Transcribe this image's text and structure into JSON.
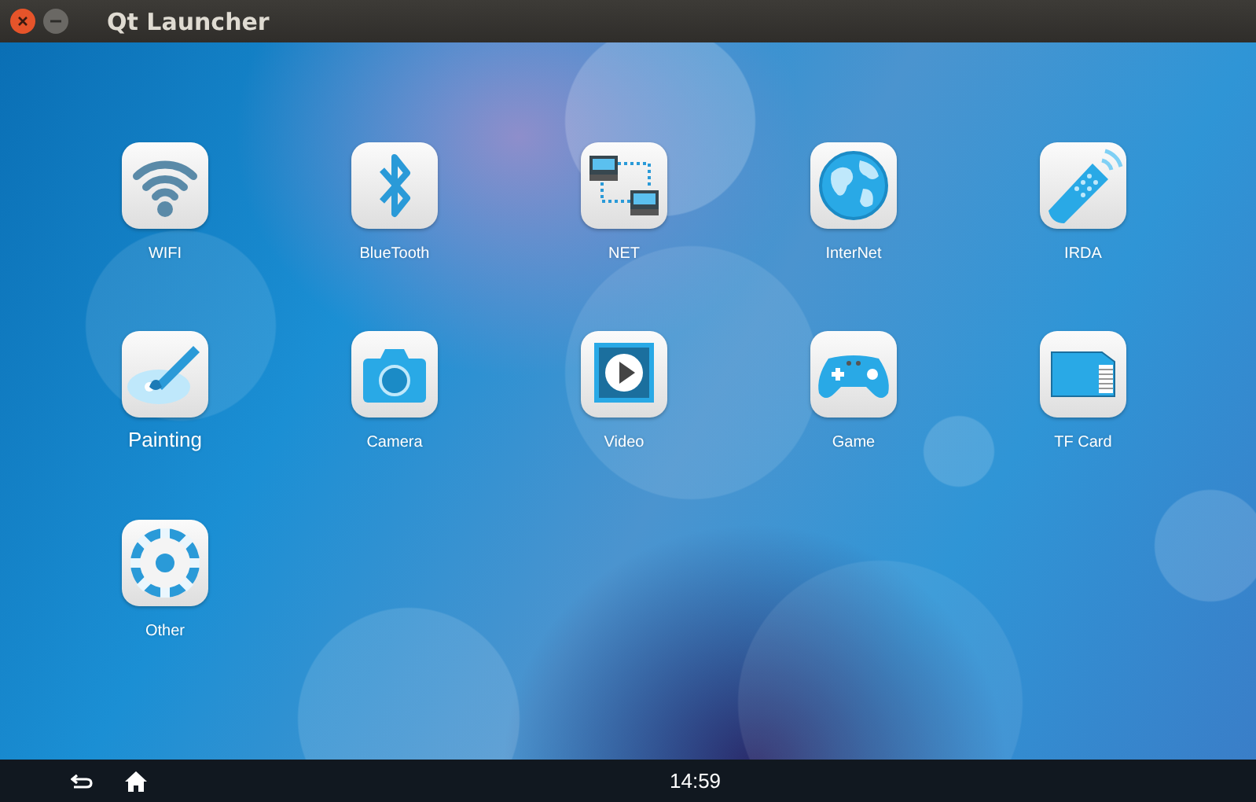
{
  "window": {
    "title": "Qt Launcher"
  },
  "apps": [
    {
      "label": "WIFI",
      "kind": "wifi",
      "selected": false
    },
    {
      "label": "BlueTooth",
      "kind": "bluetooth",
      "selected": false
    },
    {
      "label": "NET",
      "kind": "net",
      "selected": false
    },
    {
      "label": "InterNet",
      "kind": "globe",
      "selected": false
    },
    {
      "label": "IRDA",
      "kind": "remote",
      "selected": false
    },
    {
      "label": "Painting",
      "kind": "palette",
      "selected": true
    },
    {
      "label": "Camera",
      "kind": "camera",
      "selected": false
    },
    {
      "label": "Video",
      "kind": "video",
      "selected": false
    },
    {
      "label": "Game",
      "kind": "gamepad",
      "selected": false
    },
    {
      "label": "TF Card",
      "kind": "card",
      "selected": false
    },
    {
      "label": "Other",
      "kind": "gear",
      "selected": false
    }
  ],
  "status_bar": {
    "time": "14:59"
  }
}
